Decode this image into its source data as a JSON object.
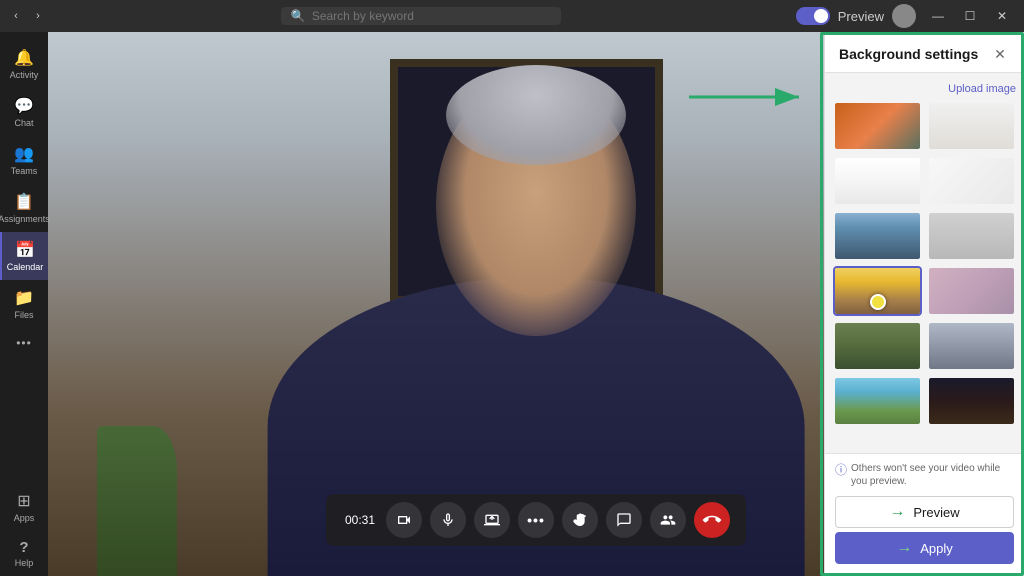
{
  "titleBar": {
    "backBtn": "‹",
    "forwardBtn": "›",
    "searchPlaceholder": "Search by keyword",
    "previewLabel": "Preview",
    "windowControls": {
      "minimize": "—",
      "maximize": "☐",
      "close": "✕"
    }
  },
  "sidebar": {
    "items": [
      {
        "id": "activity",
        "icon": "🔔",
        "label": "Activity"
      },
      {
        "id": "chat",
        "icon": "💬",
        "label": "Chat"
      },
      {
        "id": "teams",
        "icon": "👥",
        "label": "Teams"
      },
      {
        "id": "assignments",
        "icon": "📋",
        "label": "Assignments"
      },
      {
        "id": "calendar",
        "icon": "📅",
        "label": "Calendar",
        "active": true
      },
      {
        "id": "files",
        "icon": "📁",
        "label": "Files"
      },
      {
        "id": "more",
        "icon": "···",
        "label": ""
      },
      {
        "id": "apps",
        "icon": "⊞",
        "label": "Apps"
      },
      {
        "id": "help",
        "icon": "?",
        "label": "Help"
      }
    ]
  },
  "callControls": {
    "timer": "00:31",
    "buttons": [
      {
        "id": "camera",
        "icon": "🎥",
        "label": "Camera"
      },
      {
        "id": "mic",
        "icon": "🎤",
        "label": "Microphone"
      },
      {
        "id": "share",
        "icon": "⬆",
        "label": "Share Screen"
      },
      {
        "id": "more",
        "icon": "···",
        "label": "More"
      },
      {
        "id": "raise",
        "icon": "✋",
        "label": "Raise Hand"
      },
      {
        "id": "chat",
        "icon": "💬",
        "label": "Chat"
      },
      {
        "id": "participants",
        "icon": "👤",
        "label": "Participants"
      },
      {
        "id": "end",
        "icon": "📞",
        "label": "End Call",
        "variant": "end"
      }
    ]
  },
  "bgPanel": {
    "title": "Background settings",
    "closeIcon": "✕",
    "uploadLabel": "Upload image",
    "backgrounds": [
      {
        "id": "orange",
        "class": "bg-orange",
        "selected": false
      },
      {
        "id": "white-room",
        "class": "bg-white-room",
        "selected": false
      },
      {
        "id": "white-min",
        "class": "bg-white-min",
        "selected": false
      },
      {
        "id": "white-simple",
        "class": "bg-white-simple",
        "selected": false
      },
      {
        "id": "office",
        "class": "bg-office",
        "selected": false
      },
      {
        "id": "gray-room",
        "class": "bg-gray-room",
        "selected": false
      },
      {
        "id": "yellow",
        "class": "bg-yellow",
        "selected": true
      },
      {
        "id": "fantasy",
        "class": "bg-fantasy",
        "selected": false
      },
      {
        "id": "living",
        "class": "bg-living",
        "selected": false
      },
      {
        "id": "library",
        "class": "bg-library",
        "selected": false
      },
      {
        "id": "minecraft-day",
        "class": "bg-minecraft-day",
        "selected": false
      },
      {
        "id": "minecraft-dark",
        "class": "bg-minecraft-dark",
        "selected": false
      }
    ],
    "footerNote": "Others won't see your video while you preview.",
    "previewBtn": "Preview",
    "applyBtn": "Apply"
  }
}
